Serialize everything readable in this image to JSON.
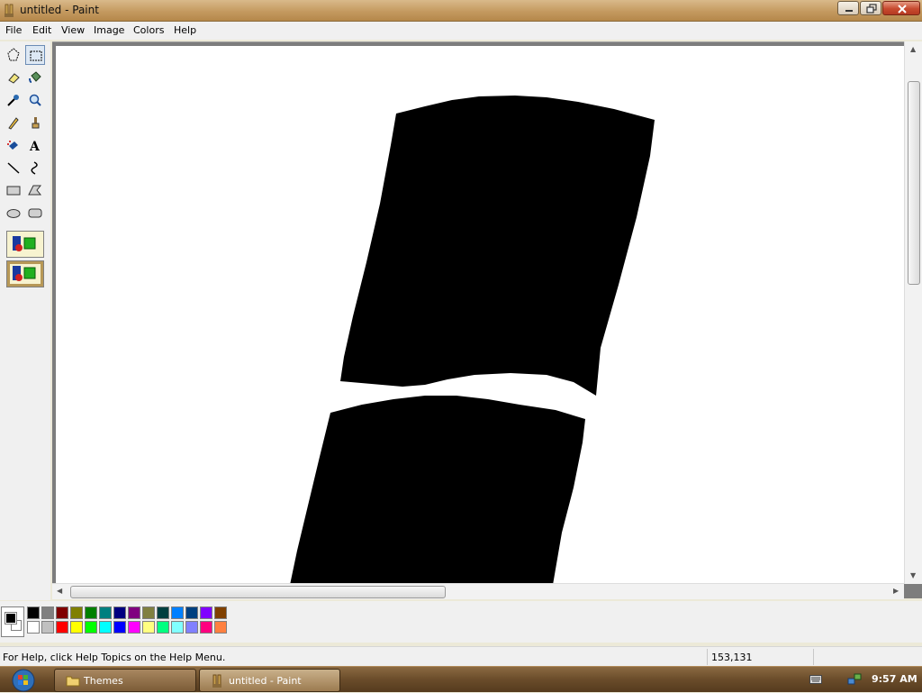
{
  "window": {
    "title": "untitled - Paint"
  },
  "menu": [
    "File",
    "Edit",
    "View",
    "Image",
    "Colors",
    "Help"
  ],
  "tools": [
    {
      "name": "free-form-select",
      "icon": "free-select-icon"
    },
    {
      "name": "select",
      "icon": "rect-select-icon",
      "selected": true
    },
    {
      "name": "eraser",
      "icon": "eraser-icon"
    },
    {
      "name": "fill-with-color",
      "icon": "fill-bucket-icon"
    },
    {
      "name": "pick-color",
      "icon": "eyedropper-icon"
    },
    {
      "name": "magnifier",
      "icon": "magnifier-icon"
    },
    {
      "name": "pencil",
      "icon": "pencil-icon"
    },
    {
      "name": "brush",
      "icon": "brush-icon"
    },
    {
      "name": "airbrush",
      "icon": "airbrush-icon"
    },
    {
      "name": "text",
      "icon": "text-icon",
      "glyph": "A"
    },
    {
      "name": "line",
      "icon": "line-icon"
    },
    {
      "name": "curve",
      "icon": "curve-icon"
    },
    {
      "name": "rectangle",
      "icon": "rectangle-icon"
    },
    {
      "name": "polygon",
      "icon": "polygon-icon"
    },
    {
      "name": "ellipse",
      "icon": "ellipse-icon"
    },
    {
      "name": "rounded-rectangle",
      "icon": "rounded-rect-icon"
    }
  ],
  "palette": {
    "foreground": "#000000",
    "background": "#ffffff",
    "colors_top": [
      "#000000",
      "#808080",
      "#800000",
      "#808000",
      "#008000",
      "#008080",
      "#000080",
      "#800080",
      "#808040",
      "#004040",
      "#0080ff",
      "#004080",
      "#8000ff",
      "#804000"
    ],
    "colors_bottom": [
      "#ffffff",
      "#c0c0c0",
      "#ff0000",
      "#ffff00",
      "#00ff00",
      "#00ffff",
      "#0000ff",
      "#ff00ff",
      "#ffff80",
      "#00ff80",
      "#80ffff",
      "#8080ff",
      "#ff0080",
      "#ff8040"
    ]
  },
  "status": {
    "help_text": "For Help, click Help Topics on the Help Menu.",
    "coordinates": "153,131"
  },
  "taskbar": {
    "items": [
      {
        "label": "Themes",
        "icon": "folder-icon"
      },
      {
        "label": "untitled - Paint",
        "icon": "paint-icon",
        "active": true
      }
    ],
    "clock": "9:57 AM"
  }
}
